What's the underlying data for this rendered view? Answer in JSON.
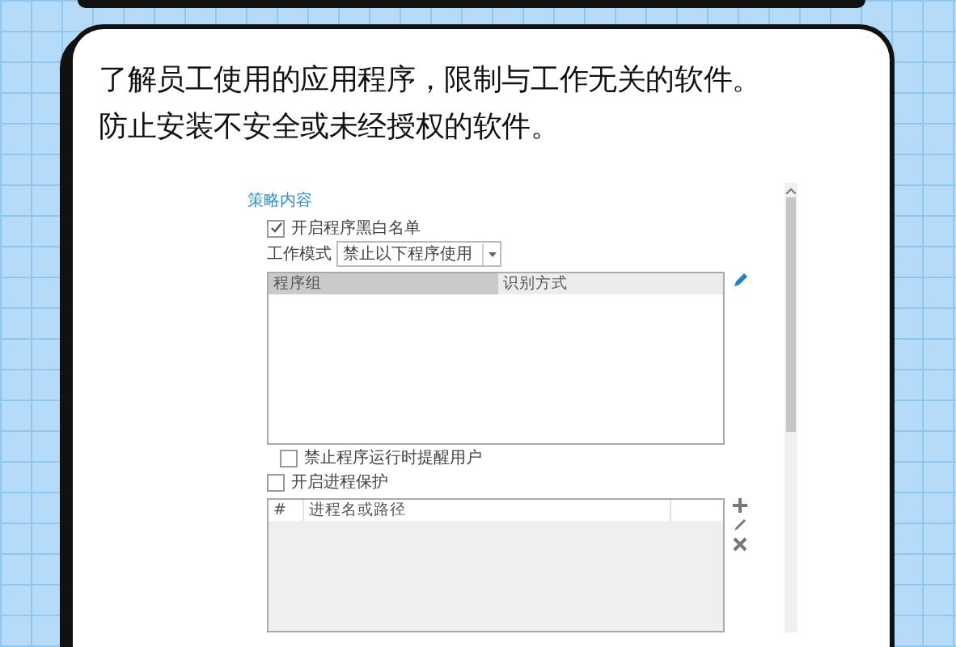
{
  "intro": {
    "lines": [
      "了解员工使用的应用程序，限制与工作无关的软件。",
      "防止安装不安全或未经授权的软件。"
    ]
  },
  "settings": {
    "title": "策略内容",
    "blackwhite_list": {
      "label": "开启程序黑白名单",
      "checked": true
    },
    "work_mode": {
      "label": "工作模式",
      "value": "禁止以下程序使用"
    },
    "program_table": {
      "columns": [
        "程序组",
        "识别方式"
      ]
    },
    "remind_user": {
      "label": "禁止程序运行时提醒用户",
      "checked": false
    },
    "process_protection": {
      "label": "开启进程保护",
      "checked": false
    },
    "process_table": {
      "columns": [
        "#",
        "进程名或路径"
      ]
    }
  }
}
